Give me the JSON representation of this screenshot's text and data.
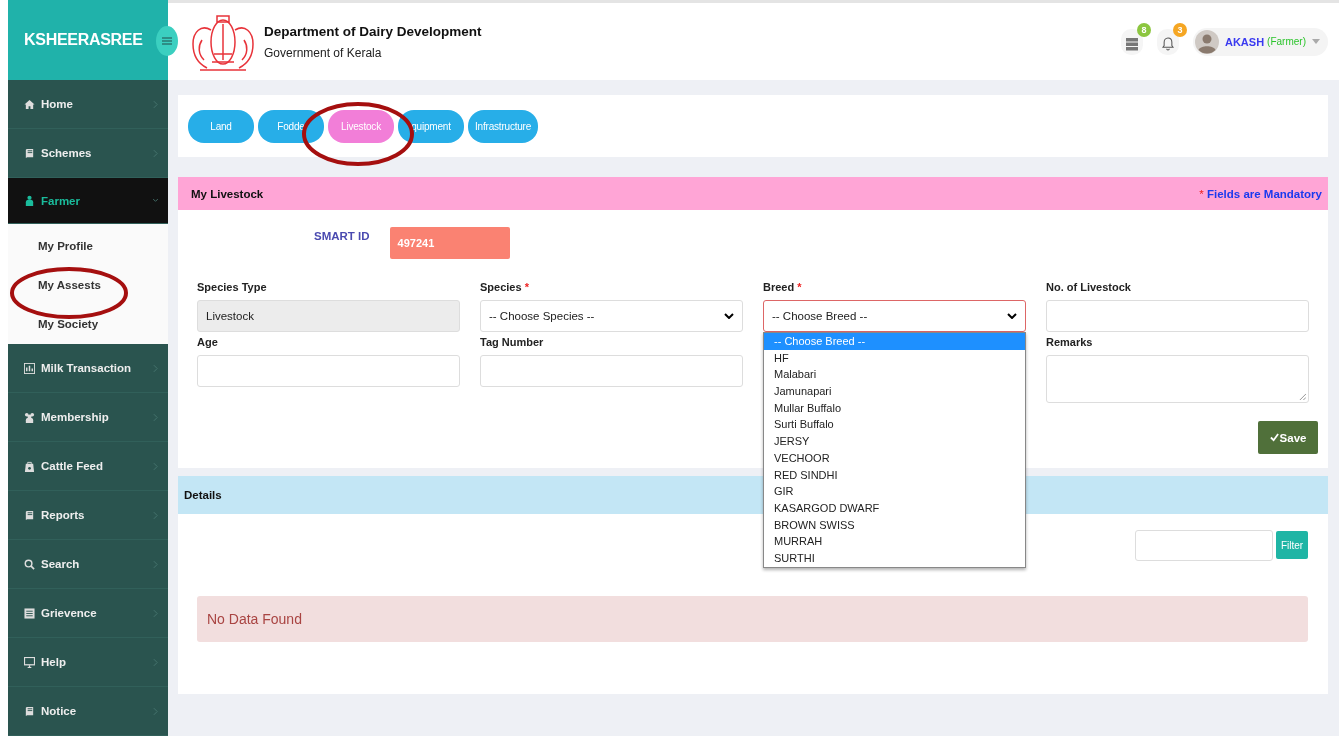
{
  "brand": "KSHEERASREE",
  "header": {
    "title": "Department of Dairy Development",
    "subtitle": "Government of Kerala",
    "badges": [
      {
        "count": "8",
        "color": "#8cc63f"
      },
      {
        "count": "3",
        "color": "#f5a623"
      }
    ],
    "user": {
      "name": "AKASH",
      "role": "(Farmer)"
    }
  },
  "sidebar": {
    "items": [
      {
        "label": "Home",
        "expanded": false
      },
      {
        "label": "Schemes",
        "expanded": false
      },
      {
        "label": "Farmer",
        "expanded": true,
        "children": [
          {
            "label": "My Profile"
          },
          {
            "label": "My Assests"
          },
          {
            "label": "My Society"
          }
        ]
      },
      {
        "label": "Milk Transaction",
        "expanded": false
      },
      {
        "label": "Membership",
        "expanded": false
      },
      {
        "label": "Cattle Feed",
        "expanded": false
      },
      {
        "label": "Reports",
        "expanded": false
      },
      {
        "label": "Search",
        "expanded": false
      },
      {
        "label": "Grievence",
        "expanded": false
      },
      {
        "label": "Help",
        "expanded": false
      },
      {
        "label": "Notice",
        "expanded": false
      }
    ]
  },
  "tabs": [
    {
      "label": "Land",
      "selected": false
    },
    {
      "label": "Fodde",
      "selected": false
    },
    {
      "label": "Livestock",
      "selected": true
    },
    {
      "label": "quipment",
      "selected": false
    },
    {
      "label": "Infrastructure",
      "selected": false
    }
  ],
  "form": {
    "title": "My Livestock",
    "mandatory_mark": "*",
    "mandatory_note": "Fields are Mandatory",
    "smart_id": {
      "label": "SMART ID",
      "value": "497241"
    },
    "fields": [
      {
        "label": "Species Type",
        "kind": "readonly",
        "required": false,
        "value": "Livestock"
      },
      {
        "label": "Species",
        "kind": "select",
        "required": true,
        "value": "-- Choose Species --"
      },
      {
        "label": "Breed",
        "kind": "select",
        "required": true,
        "value": "-- Choose Breed --",
        "open": true,
        "options": [
          {
            "label": "-- Choose Breed --",
            "selected": true
          },
          {
            "label": "HF",
            "selected": false
          },
          {
            "label": "Malabari",
            "selected": false
          },
          {
            "label": "Jamunapari",
            "selected": false
          },
          {
            "label": "Mullar Buffalo",
            "selected": false
          },
          {
            "label": "Surti Buffalo",
            "selected": false
          },
          {
            "label": "JERSY",
            "selected": false
          },
          {
            "label": "VECHOOR",
            "selected": false
          },
          {
            "label": "RED SINDHI",
            "selected": false
          },
          {
            "label": "GIR",
            "selected": false
          },
          {
            "label": "KASARGOD DWARF",
            "selected": false
          },
          {
            "label": "BROWN SWISS",
            "selected": false
          },
          {
            "label": "MURRAH",
            "selected": false
          },
          {
            "label": "SURTHI",
            "selected": false
          }
        ]
      },
      {
        "label": "No. of Livestock",
        "kind": "input",
        "required": false
      },
      {
        "label": "Age",
        "kind": "input",
        "required": false
      },
      {
        "label": "Tag Number",
        "kind": "input",
        "required": false
      },
      {
        "label": "Remarks",
        "kind": "textarea",
        "required": false
      }
    ],
    "save_button": "Save"
  },
  "details": {
    "title": "Details",
    "filter_button": "Filter",
    "empty_message": "No Data Found"
  }
}
